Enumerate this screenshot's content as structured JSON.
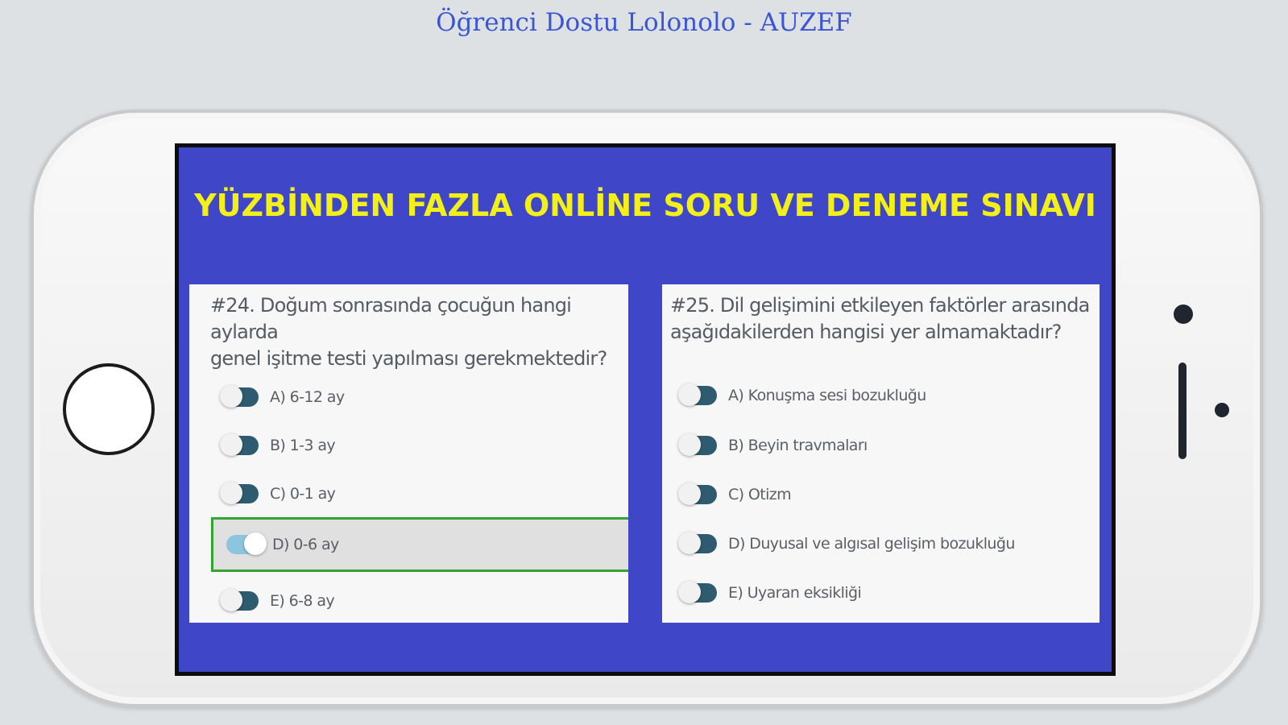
{
  "page_title": "Öğrenci Dostu Lolonolo - AUZEF",
  "banner": "YÜZBİNDEN FAZLA ONLİNE SORU VE DENEME SINAVI",
  "questions": [
    {
      "text": "#24. Doğum sonrasında çocuğun hangi aylarda\ngenel işitme testi yapılması gerekmektedir?",
      "options": [
        "A) 6-12 ay",
        "B) 1-3 ay",
        "C) 0-1 ay",
        "D) 0-6 ay",
        "E) 6-8 ay"
      ],
      "selected": "D) 0-6 ay"
    },
    {
      "text": "#25. Dil gelişimini etkileyen faktörler arasında\naşağıdakilerden hangisi yer almamaktadır?",
      "options": [
        "A) Konuşma sesi bozukluğu",
        "B) Beyin travmaları",
        "C) Otizm",
        "D) Duyusal ve algısal gelişim bozukluğu",
        "E) Uyaran eksikliği"
      ],
      "selected": ""
    }
  ],
  "colors": {
    "background": "#dde1e4",
    "title": "#3a56d4",
    "screen": "#3f46c8",
    "banner_text": "#f3ef1a",
    "selected_border": "#33a433",
    "toggle_off": "#2f5b70",
    "toggle_on": "#8dc5e0"
  },
  "icons": {
    "home_button": "home-button-icon",
    "camera": "camera-icon",
    "speaker": "speaker-icon",
    "sensor": "sensor-icon"
  }
}
